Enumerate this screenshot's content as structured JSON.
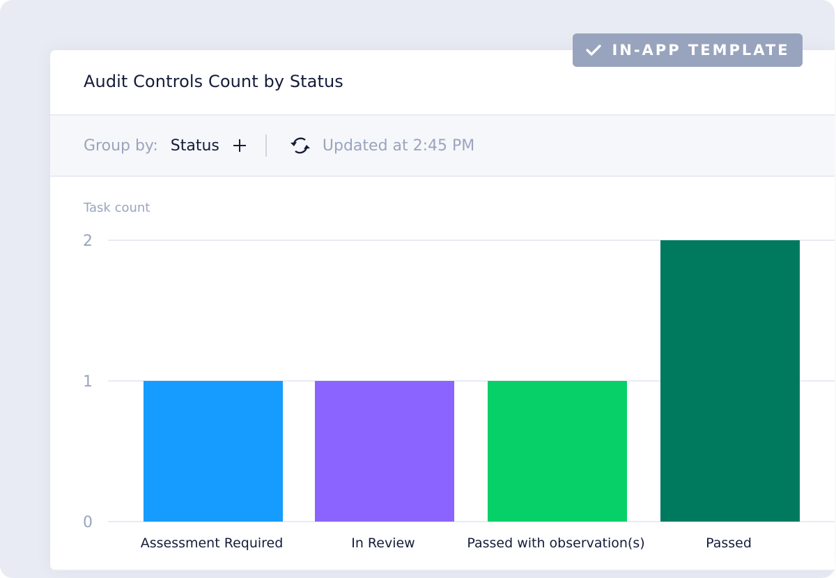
{
  "badge": {
    "icon": "check-icon",
    "label": "IN-APP TEMPLATE"
  },
  "card": {
    "title": "Audit Controls Count by Status"
  },
  "toolbar": {
    "group_by_label": "Group by:",
    "group_by_value": "Status",
    "add_icon": "plus-icon",
    "refresh_icon": "refresh-icon",
    "updated_text": "Updated at 2:45 PM"
  },
  "chart_data": {
    "type": "bar",
    "title": "Audit Controls Count by Status",
    "ylabel": "Task count",
    "xlabel": "",
    "categories": [
      "Assessment Required",
      "In Review",
      "Passed with observation(s)",
      "Passed"
    ],
    "values": [
      1,
      1,
      1,
      2
    ],
    "colors": [
      "#169bff",
      "#8b63ff",
      "#08d068",
      "#007a5e"
    ],
    "ylim": [
      0,
      2
    ],
    "yticks": [
      0,
      1,
      2
    ],
    "grid": true,
    "legend": "none"
  }
}
